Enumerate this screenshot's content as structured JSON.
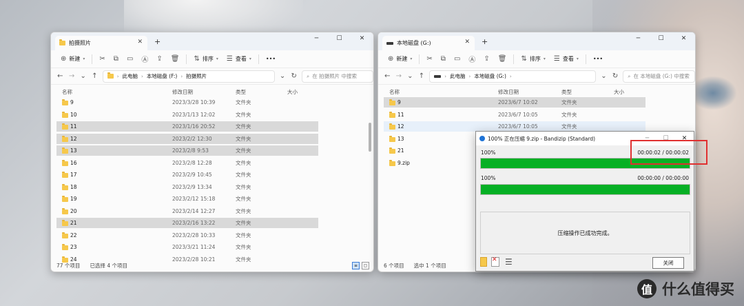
{
  "watermark": {
    "badge": "值",
    "text": "什么值得买"
  },
  "left_window": {
    "tab_title": "拍摄照片",
    "toolbar": {
      "new": "新建",
      "sort": "排序",
      "view": "查看",
      "more": "•••"
    },
    "path": [
      "此电脑",
      "本地磁盘 (F:)",
      "拍摄照片"
    ],
    "search_placeholder": "在 拍摄照片 中搜索",
    "columns": {
      "name": "名称",
      "date": "修改日期",
      "type": "类型",
      "size": "大小"
    },
    "rows": [
      {
        "name": "9",
        "date": "2023/3/28 10:39",
        "type": "文件夹",
        "selected": false
      },
      {
        "name": "10",
        "date": "2023/1/13 12:02",
        "type": "文件夹",
        "selected": false
      },
      {
        "name": "11",
        "date": "2023/1/16 20:52",
        "type": "文件夹",
        "selected": true
      },
      {
        "name": "12",
        "date": "2023/2/2 12:30",
        "type": "文件夹",
        "selected": true
      },
      {
        "name": "13",
        "date": "2023/2/8 9:53",
        "type": "文件夹",
        "selected": true
      },
      {
        "name": "16",
        "date": "2023/2/8 12:28",
        "type": "文件夹",
        "selected": false
      },
      {
        "name": "17",
        "date": "2023/2/9 10:45",
        "type": "文件夹",
        "selected": false
      },
      {
        "name": "18",
        "date": "2023/2/9 13:34",
        "type": "文件夹",
        "selected": false
      },
      {
        "name": "19",
        "date": "2023/2/12 15:18",
        "type": "文件夹",
        "selected": false
      },
      {
        "name": "20",
        "date": "2023/2/14 12:27",
        "type": "文件夹",
        "selected": false
      },
      {
        "name": "21",
        "date": "2023/2/16 13:22",
        "type": "文件夹",
        "selected": true
      },
      {
        "name": "22",
        "date": "2023/2/28 10:33",
        "type": "文件夹",
        "selected": false
      },
      {
        "name": "23",
        "date": "2023/3/21 11:24",
        "type": "文件夹",
        "selected": false
      },
      {
        "name": "24",
        "date": "2023/2/28 10:21",
        "type": "文件夹",
        "selected": false
      }
    ],
    "status": {
      "count": "77 个项目",
      "selected": "已选择 4 个项目"
    }
  },
  "right_window": {
    "tab_title": "本地磁盘 (G:)",
    "toolbar": {
      "new": "新建",
      "sort": "排序",
      "view": "查看",
      "more": "•••"
    },
    "path": [
      "此电脑",
      "本地磁盘 (G:)"
    ],
    "search_placeholder": "在 本地磁盘 (G:) 中搜索",
    "columns": {
      "name": "名称",
      "date": "修改日期",
      "type": "类型",
      "size": "大小"
    },
    "rows": [
      {
        "name": "9",
        "date": "2023/6/7 10:02",
        "type": "文件夹",
        "state": "selected"
      },
      {
        "name": "11",
        "date": "2023/6/7 10:05",
        "type": "文件夹",
        "state": ""
      },
      {
        "name": "12",
        "date": "2023/6/7 10:05",
        "type": "文件夹",
        "state": "hover"
      },
      {
        "name": "13",
        "date": "",
        "type": "",
        "state": ""
      },
      {
        "name": "21",
        "date": "",
        "type": "",
        "state": ""
      },
      {
        "name": "9.zip",
        "date": "",
        "type": "",
        "state": ""
      }
    ],
    "status": {
      "count": "6 个项目",
      "selected": "选中 1 个项目"
    }
  },
  "bandizip": {
    "title": "100% 正在压缩 9.zip - Bandizip (Standard)",
    "progress1": {
      "label": "100%",
      "time": "00:00:02 / 00:00:02",
      "value": 1.0
    },
    "progress2": {
      "label": "100%",
      "time": "00:00:00 / 00:00:00",
      "value": 1.0
    },
    "message": "压缩操作已成功完成。",
    "close_button": "关闭",
    "colors": {
      "progress": "#06b025",
      "highlight": "#e03030"
    }
  }
}
